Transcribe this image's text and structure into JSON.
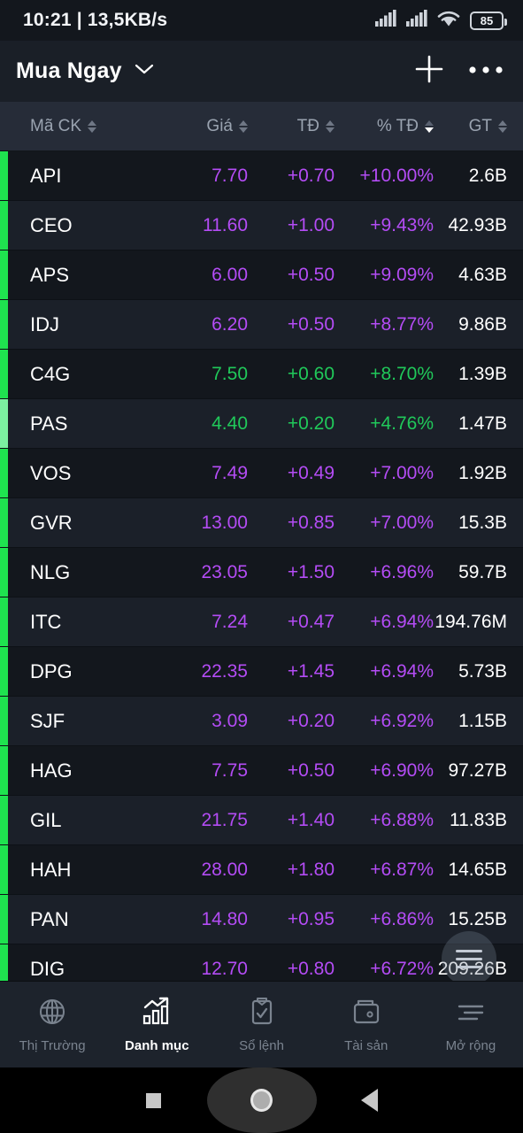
{
  "status_bar": {
    "time": "10:21",
    "separator": "|",
    "network_speed": "13,5KB/s",
    "battery_level": "85",
    "icons": [
      "signal-bars-icon",
      "signal-bars-icon",
      "wifi-icon",
      "battery-icon"
    ]
  },
  "title_bar": {
    "title": "Mua Ngay",
    "dropdown_icon": "chevron-down-icon",
    "add_icon": "plus-icon",
    "more_icon": "more-horizontal-icon"
  },
  "table": {
    "columns": [
      {
        "label": "Mã CK",
        "sorted": false
      },
      {
        "label": "Giá",
        "sorted": false
      },
      {
        "label": "TĐ",
        "sorted": false
      },
      {
        "label": "% TĐ",
        "sorted": true
      },
      {
        "label": "GT",
        "sorted": false
      }
    ],
    "rows": [
      {
        "symbol": "API",
        "price": "7.70",
        "change": "+0.70",
        "percent": "+10.00%",
        "value": "2.6B",
        "state": "ceiling-purple",
        "bar": "green"
      },
      {
        "symbol": "CEO",
        "price": "11.60",
        "change": "+1.00",
        "percent": "+9.43%",
        "value": "42.93B",
        "state": "ceiling-purple",
        "bar": "green"
      },
      {
        "symbol": "APS",
        "price": "6.00",
        "change": "+0.50",
        "percent": "+9.09%",
        "value": "4.63B",
        "state": "ceiling-purple",
        "bar": "green"
      },
      {
        "symbol": "IDJ",
        "price": "6.20",
        "change": "+0.50",
        "percent": "+8.77%",
        "value": "9.86B",
        "state": "ceiling-purple",
        "bar": "green"
      },
      {
        "symbol": "C4G",
        "price": "7.50",
        "change": "+0.60",
        "percent": "+8.70%",
        "value": "1.39B",
        "state": "up-green",
        "bar": "green"
      },
      {
        "symbol": "PAS",
        "price": "4.40",
        "change": "+0.20",
        "percent": "+4.76%",
        "value": "1.47B",
        "state": "up-green",
        "bar": "light-green"
      },
      {
        "symbol": "VOS",
        "price": "7.49",
        "change": "+0.49",
        "percent": "+7.00%",
        "value": "1.92B",
        "state": "ceiling-purple",
        "bar": "green"
      },
      {
        "symbol": "GVR",
        "price": "13.00",
        "change": "+0.85",
        "percent": "+7.00%",
        "value": "15.3B",
        "state": "ceiling-purple",
        "bar": "green"
      },
      {
        "symbol": "NLG",
        "price": "23.05",
        "change": "+1.50",
        "percent": "+6.96%",
        "value": "59.7B",
        "state": "ceiling-purple",
        "bar": "green"
      },
      {
        "symbol": "ITC",
        "price": "7.24",
        "change": "+0.47",
        "percent": "+6.94%",
        "value": "194.76M",
        "state": "ceiling-purple",
        "bar": "green"
      },
      {
        "symbol": "DPG",
        "price": "22.35",
        "change": "+1.45",
        "percent": "+6.94%",
        "value": "5.73B",
        "state": "ceiling-purple",
        "bar": "green"
      },
      {
        "symbol": "SJF",
        "price": "3.09",
        "change": "+0.20",
        "percent": "+6.92%",
        "value": "1.15B",
        "state": "ceiling-purple",
        "bar": "green"
      },
      {
        "symbol": "HAG",
        "price": "7.75",
        "change": "+0.50",
        "percent": "+6.90%",
        "value": "97.27B",
        "state": "ceiling-purple",
        "bar": "green"
      },
      {
        "symbol": "GIL",
        "price": "21.75",
        "change": "+1.40",
        "percent": "+6.88%",
        "value": "11.83B",
        "state": "ceiling-purple",
        "bar": "green"
      },
      {
        "symbol": "HAH",
        "price": "28.00",
        "change": "+1.80",
        "percent": "+6.87%",
        "value": "14.65B",
        "state": "ceiling-purple",
        "bar": "green"
      },
      {
        "symbol": "PAN",
        "price": "14.80",
        "change": "+0.95",
        "percent": "+6.86%",
        "value": "15.25B",
        "state": "ceiling-purple",
        "bar": "green"
      },
      {
        "symbol": "DIG",
        "price": "12.70",
        "change": "+0.80",
        "percent": "+6.72%",
        "value": "209.26B",
        "state": "ceiling-purple",
        "bar": "green"
      }
    ]
  },
  "fab": {
    "icon": "hamburger-menu-icon"
  },
  "bottom_nav": {
    "items": [
      {
        "label": "Thị Trường",
        "icon": "globe-icon",
        "active": false
      },
      {
        "label": "Danh mục",
        "icon": "bar-chart-icon",
        "active": true
      },
      {
        "label": "Sổ lệnh",
        "icon": "clipboard-check-icon",
        "active": false
      },
      {
        "label": "Tài sản",
        "icon": "wallet-icon",
        "active": false
      },
      {
        "label": "Mở rộng",
        "icon": "menu-lines-icon",
        "active": false
      }
    ]
  },
  "android_nav": {
    "recents_icon": "square-icon",
    "home_icon": "circle-icon",
    "back_icon": "triangle-back-icon"
  },
  "colors": {
    "ceiling_purple": "#b44cf5",
    "up_green": "#20c95a",
    "bar_green": "#1fe34f",
    "bar_light_green": "#7cf0a0",
    "row_dark": "#13171d",
    "row_light": "#1b2029",
    "header_bg": "#262c38",
    "title_bg": "#1a1f27"
  }
}
